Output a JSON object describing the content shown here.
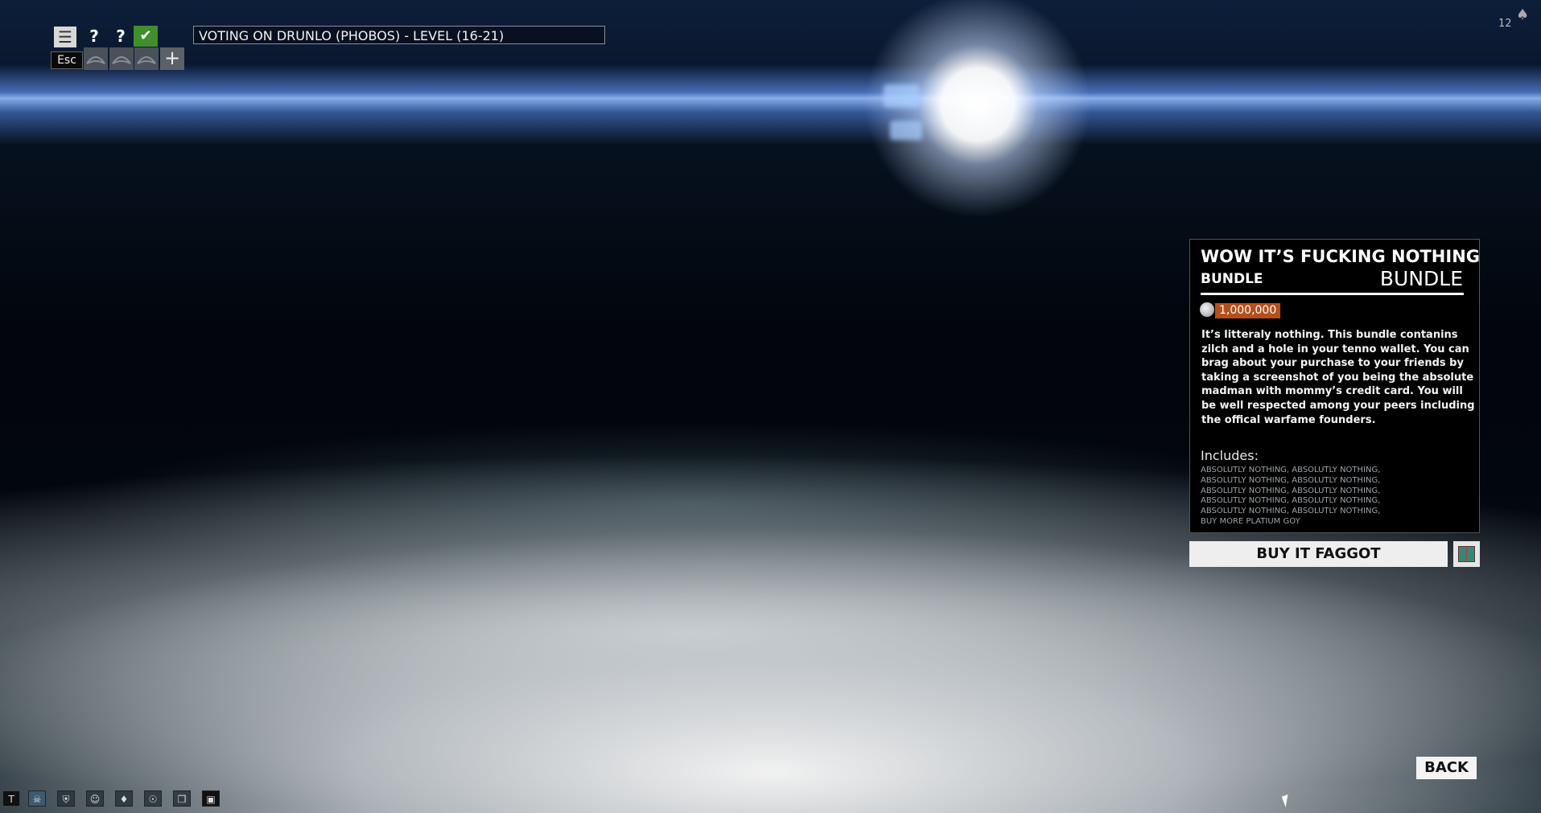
{
  "hud": {
    "menu_icon": "hamburger-icon",
    "help_1": "?",
    "help_2": "?",
    "ready_icon": "check-icon",
    "esc_label": "Esc",
    "squad_add": "+",
    "vote_text": "VOTING ON DRUNLO (PHOBOS) - LEVEL (16-21)",
    "corner_count": "12"
  },
  "bundle": {
    "title": "WOW IT’S FUCKING NOTHING",
    "subtitle": "BUNDLE",
    "type": "BUNDLE",
    "price": "1,000,000",
    "description": "It’s litteraly nothing. This bundle contanins zilch and a hole in your tenno wallet. You can brag about your purchase to your friends by taking a screenshot of you being the absolute madman with mommy’s credit card. You will be well respected among your peers including the offical warfame founders.",
    "includes_label": "Includes:",
    "includes": [
      "ABSOLUTLY NOTHING, ABSOLUTLY NOTHING,",
      "ABSOLUTLY NOTHING, ABSOLUTLY NOTHING,",
      "ABSOLUTLY NOTHING, ABSOLUTLY NOTHING,",
      "ABSOLUTLY NOTHING, ABSOLUTLY NOTHING,",
      "ABSOLUTLY NOTHING, ABSOLUTLY NOTHING,",
      "BUY MORE PLATIUM GOY"
    ],
    "buy_label": "BUY IT FAGGOT",
    "gift_icon": "gift-icon"
  },
  "back_label": "BACK",
  "hotbar": [
    "T",
    "☠",
    "⛨",
    "☺",
    "♦",
    "☉",
    "❐",
    "▣"
  ],
  "colors": {
    "price_badge": "#b5501a",
    "ready": "#3f8f2a"
  }
}
